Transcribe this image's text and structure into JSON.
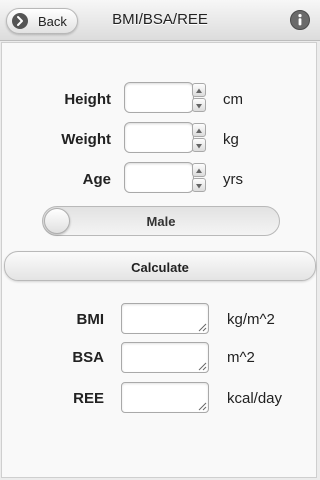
{
  "header": {
    "title": "BMI/BSA/REE",
    "back_label": "Back",
    "back_icon": "chevron-right-circle-icon",
    "info_icon": "info-icon"
  },
  "inputs": {
    "height": {
      "label": "Height",
      "unit": "cm",
      "value": ""
    },
    "weight": {
      "label": "Weight",
      "unit": "kg",
      "value": ""
    },
    "age": {
      "label": "Age",
      "unit": "yrs",
      "value": ""
    }
  },
  "gender_toggle": {
    "label": "Male"
  },
  "calculate_label": "Calculate",
  "results": {
    "bmi": {
      "label": "BMI",
      "unit": "kg/m^2",
      "value": ""
    },
    "bsa": {
      "label": "BSA",
      "unit": "m^2",
      "value": ""
    },
    "ree": {
      "label": "REE",
      "unit": "kcal/day",
      "value": ""
    }
  }
}
